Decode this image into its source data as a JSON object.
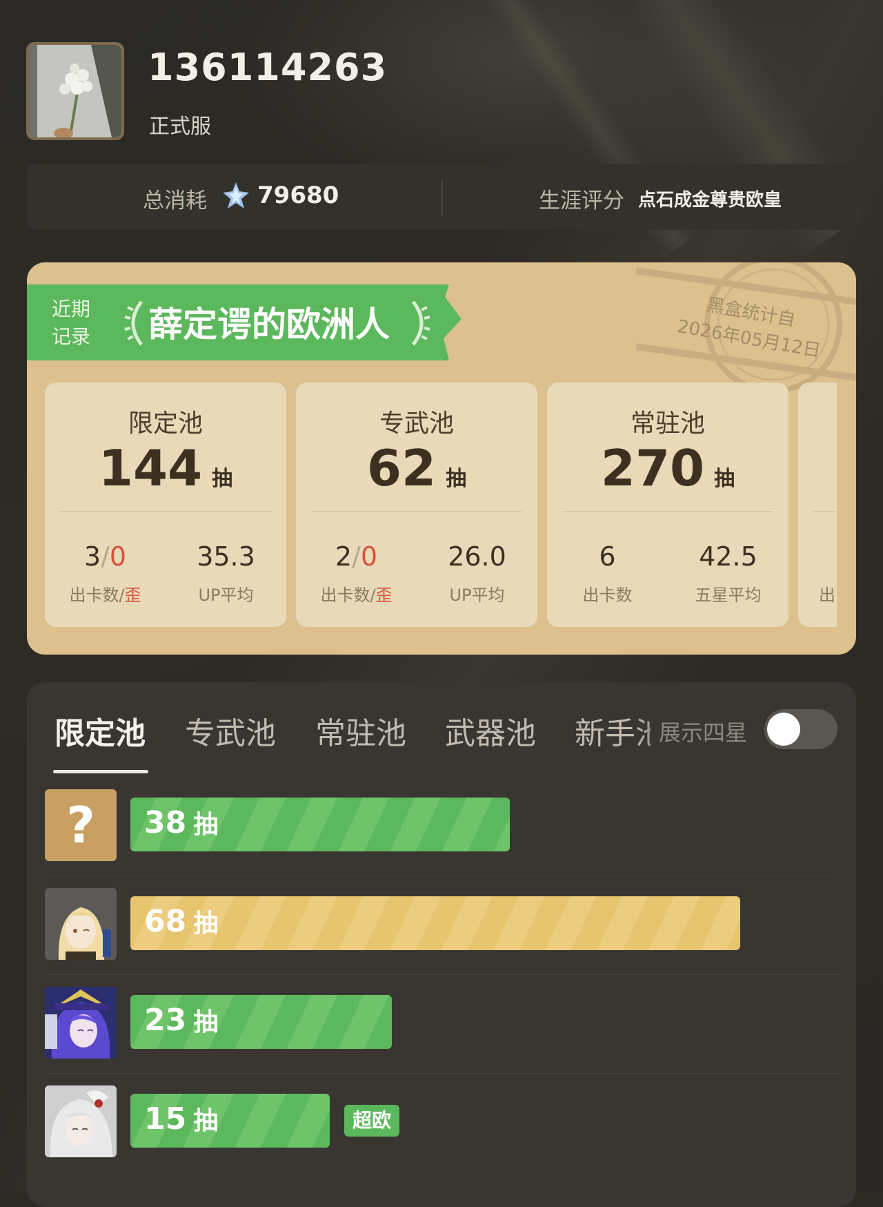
{
  "profile": {
    "uid": "136114263",
    "server": "正式服"
  },
  "stats": {
    "total_label": "总消耗",
    "total_icon": "star-jade-icon",
    "total_value": "79680",
    "career_label": "生涯评分",
    "career_value": "点石成金尊贵欧皇"
  },
  "recent": {
    "ribbon_line1": "近期",
    "ribbon_line2": "记录",
    "title": "薛定谔的欧洲人",
    "stamp_line1": "黑盒统计自",
    "stamp_line2": "2026年05月12日",
    "pools": [
      {
        "name": "限定池",
        "count": "144",
        "unit": "抽",
        "stat1_a": "3",
        "stat1_sep": "/",
        "stat1_b": "0",
        "stat1_label_a": "出卡数/",
        "stat1_label_b": "歪",
        "stat2": "35.3",
        "stat2_label": "UP平均"
      },
      {
        "name": "专武池",
        "count": "62",
        "unit": "抽",
        "stat1_a": "2",
        "stat1_sep": "/",
        "stat1_b": "0",
        "stat1_label_a": "出卡数/",
        "stat1_label_b": "歪",
        "stat2": "26.0",
        "stat2_label": "UP平均"
      },
      {
        "name": "常驻池",
        "count": "270",
        "unit": "抽",
        "stat1_a": "6",
        "stat1_label_a": "出卡数",
        "stat2": "42.5",
        "stat2_label": "五星平均"
      },
      {
        "partial_label": "出"
      }
    ]
  },
  "tabs": {
    "items": [
      "限定池",
      "专武池",
      "常驻池",
      "武器池",
      "新手池"
    ],
    "active": 0,
    "toggle_label": "展示四星",
    "toggle_on": false
  },
  "rows": [
    {
      "portrait": "unknown-icon",
      "portrait_text": "?",
      "count": "38",
      "unit": "抽",
      "color": "green",
      "max": 90
    },
    {
      "portrait": "character-avatar-blonde",
      "count": "68",
      "unit": "抽",
      "color": "yellow",
      "max": 90
    },
    {
      "portrait": "character-avatar-purple-hair",
      "count": "23",
      "unit": "抽",
      "color": "green",
      "max": 90
    },
    {
      "portrait": "character-avatar-white-hair",
      "count": "15",
      "unit": "抽",
      "color": "green",
      "max": 90,
      "badge": "超欧"
    }
  ],
  "colors": {
    "green": "#5cb85c",
    "yellow": "#e7c46e",
    "red": "#d8513a",
    "card": "#dcc08e"
  }
}
